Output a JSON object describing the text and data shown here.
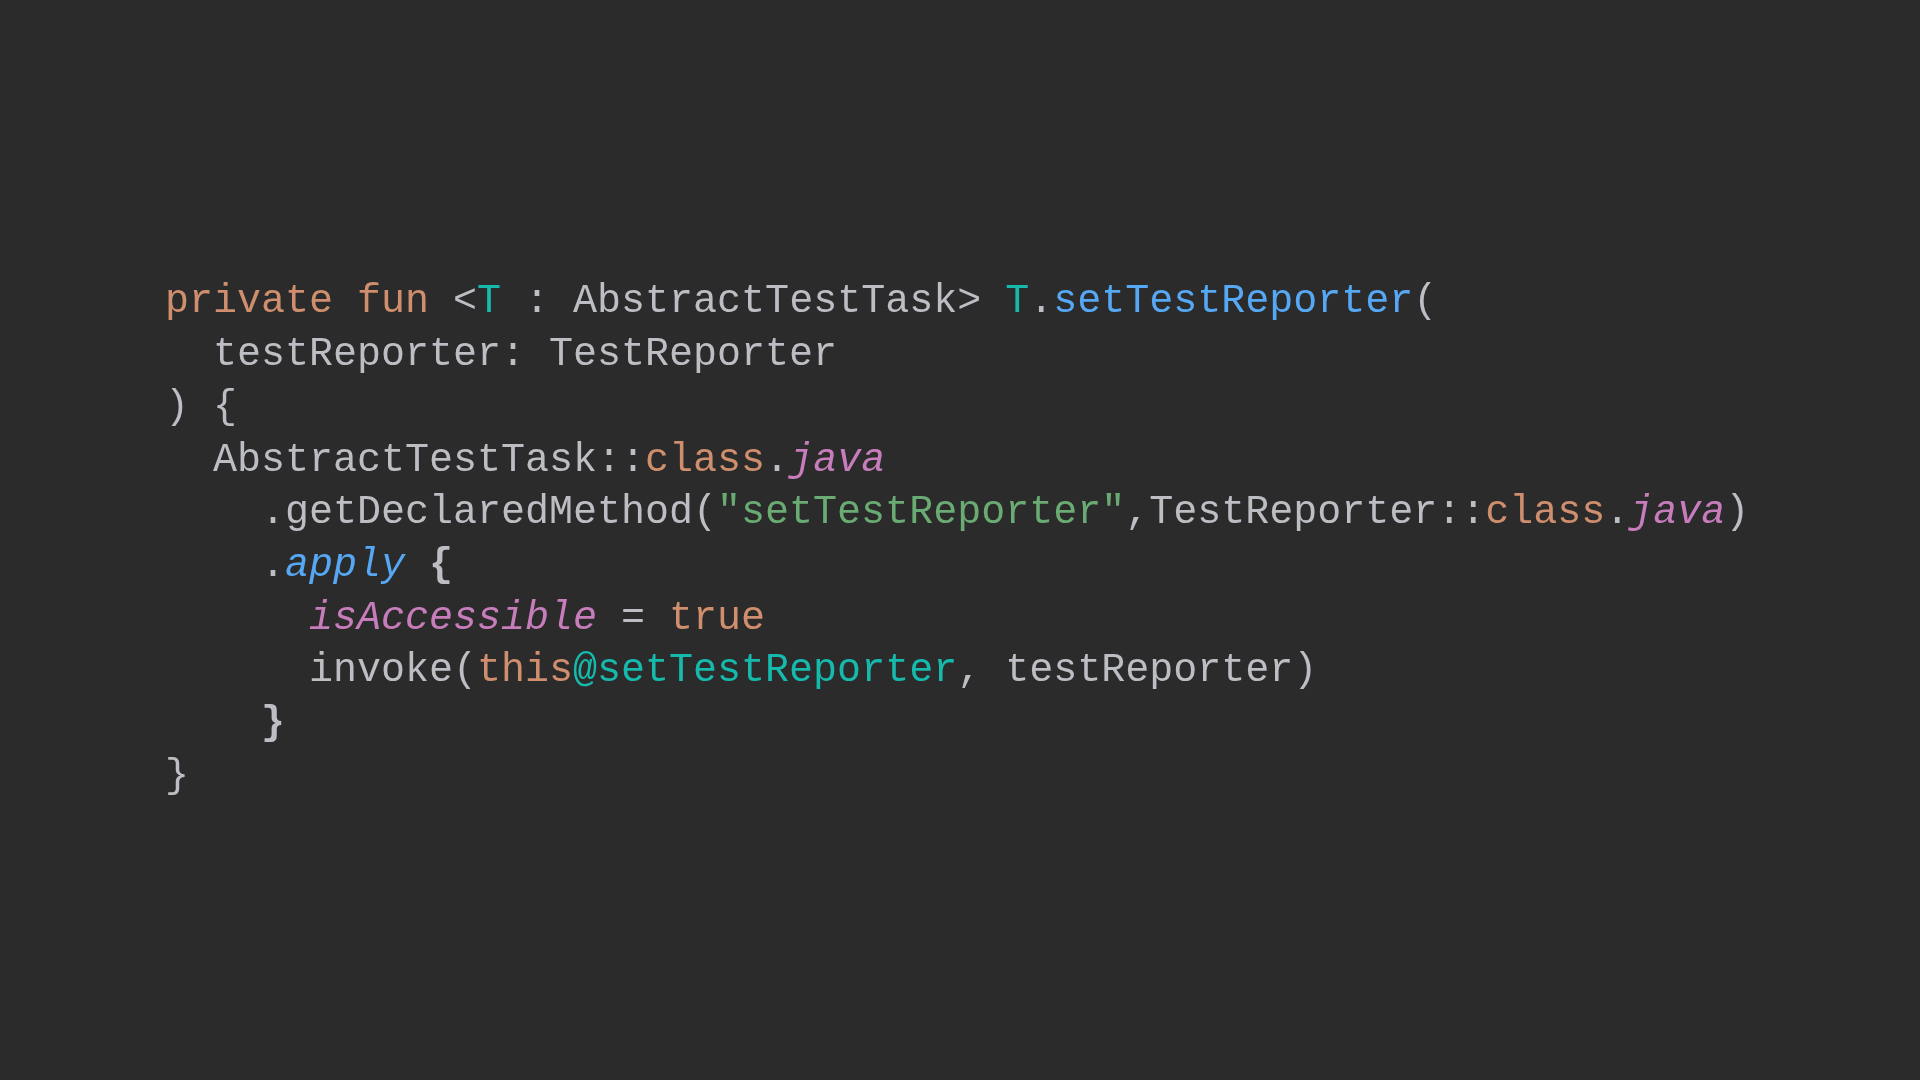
{
  "code_lines": [
    {
      "tokens": [
        {
          "kind": "keyword",
          "text": "private fun "
        },
        {
          "kind": "plain",
          "text": "<"
        },
        {
          "kind": "type_param",
          "text": "T"
        },
        {
          "kind": "plain",
          "text": " : AbstractTestTask> "
        },
        {
          "kind": "type_param",
          "text": "T"
        },
        {
          "kind": "plain",
          "text": "."
        },
        {
          "kind": "function",
          "text": "setTestReporter"
        },
        {
          "kind": "plain",
          "text": "("
        }
      ]
    },
    {
      "tokens": [
        {
          "kind": "plain",
          "text": "  testReporter: TestReporter"
        }
      ]
    },
    {
      "tokens": [
        {
          "kind": "plain",
          "text": ") {"
        }
      ]
    },
    {
      "tokens": [
        {
          "kind": "plain",
          "text": "  AbstractTestTask::"
        },
        {
          "kind": "keyword",
          "text": "class"
        },
        {
          "kind": "plain",
          "text": "."
        },
        {
          "kind": "property",
          "text": "java"
        }
      ]
    },
    {
      "tokens": [
        {
          "kind": "plain",
          "text": "    .getDeclaredMethod("
        },
        {
          "kind": "string",
          "text": "\"setTestReporter\""
        },
        {
          "kind": "plain",
          "text": ",TestReporter::"
        },
        {
          "kind": "keyword",
          "text": "class"
        },
        {
          "kind": "plain",
          "text": "."
        },
        {
          "kind": "property",
          "text": "java"
        },
        {
          "kind": "plain",
          "text": ")"
        }
      ]
    },
    {
      "tokens": [
        {
          "kind": "plain",
          "text": "    ."
        },
        {
          "kind": "extension",
          "text": "apply"
        },
        {
          "kind": "brace",
          "text": " {"
        }
      ]
    },
    {
      "tokens": [
        {
          "kind": "property",
          "text": "      isAccessible"
        },
        {
          "kind": "plain",
          "text": " = "
        },
        {
          "kind": "keyword",
          "text": "true"
        }
      ]
    },
    {
      "tokens": [
        {
          "kind": "plain",
          "text": "      invoke("
        },
        {
          "kind": "keyword",
          "text": "this"
        },
        {
          "kind": "label",
          "text": "@setTestReporter"
        },
        {
          "kind": "plain",
          "text": ", testReporter)"
        }
      ]
    },
    {
      "tokens": [
        {
          "kind": "brace",
          "text": "    }"
        }
      ]
    },
    {
      "tokens": [
        {
          "kind": "plain",
          "text": "}"
        }
      ]
    }
  ]
}
